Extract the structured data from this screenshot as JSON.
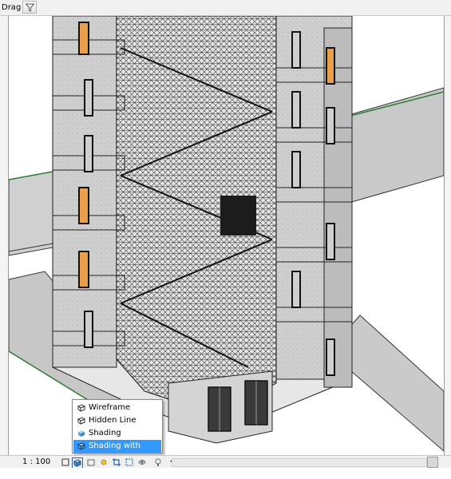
{
  "toolbar": {
    "drag_label": "Drag",
    "filter_icon": "filter-icon"
  },
  "view_control_bar": {
    "scale": "1 : 100",
    "icons": [
      "detail-level-icon",
      "visual-style-icon",
      "sun-path-icon",
      "shadows-icon",
      "crop-view-icon",
      "show-crop-region-icon",
      "temporary-hide-icon"
    ]
  },
  "visual_style_menu": {
    "items": [
      {
        "label": "Wireframe",
        "icon": "wireframe-icon",
        "selected": false
      },
      {
        "label": "Hidden Line",
        "icon": "hidden-line-icon",
        "selected": false
      },
      {
        "label": "Shading",
        "icon": "shading-icon",
        "selected": false
      },
      {
        "label": "Shading with Edges",
        "icon": "shading-with-edges-icon",
        "selected": true
      }
    ],
    "highlight_color": "#3399ff"
  },
  "model_view": {
    "description_colors": {
      "wall": "#cfcfcf",
      "floor": "#bdbdbd",
      "edge": "#1a1a1a",
      "door_panel": "#e8a04a",
      "ground_line": "#2e7d32"
    }
  }
}
